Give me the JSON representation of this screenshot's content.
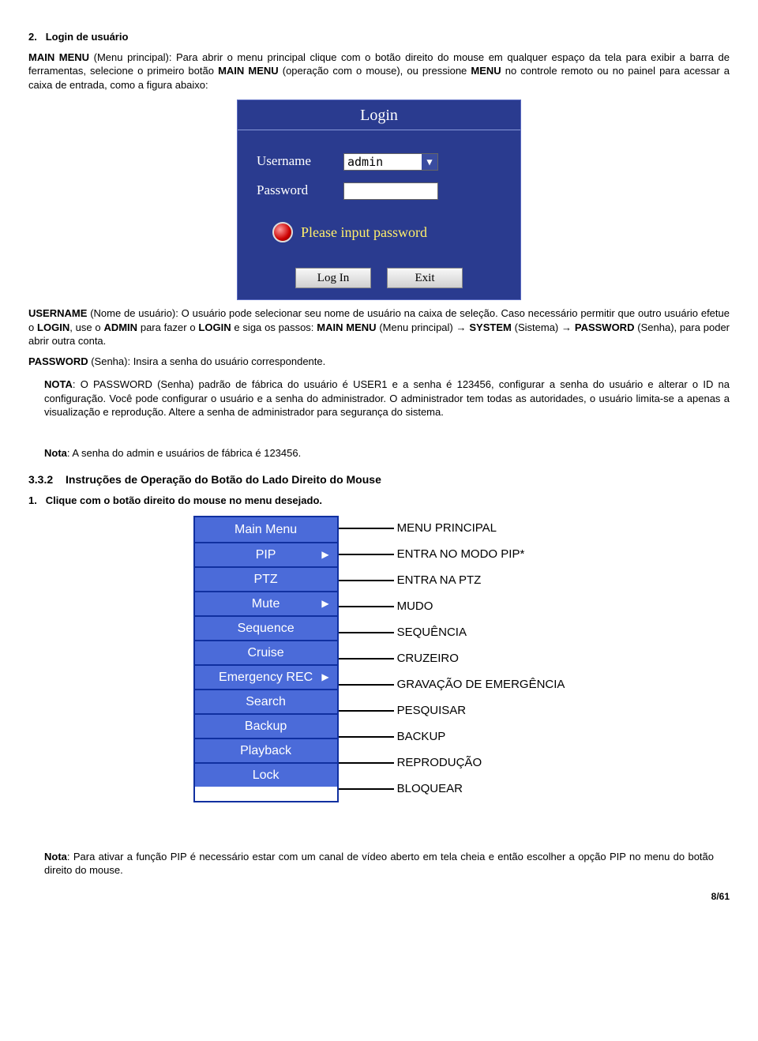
{
  "sec2": {
    "num": "2.",
    "title": "Login de usuário",
    "p1_a": "MAIN MENU",
    "p1_b": " (Menu principal): Para abrir o menu principal clique com o botão direito do mouse em qualquer espaço da tela para exibir a barra de ferramentas, selecione o primeiro botão ",
    "p1_c": "MAIN MENU",
    "p1_d": " (operação com o mouse), ou pressione ",
    "p1_e": "MENU",
    "p1_f": " no controle remoto ou no painel para acessar a caixa de entrada, como a figura abaixo:"
  },
  "login": {
    "title": "Login",
    "user_lbl": "Username",
    "user_val": "admin",
    "pass_lbl": "Password",
    "warn": "Please input password",
    "btn_login": "Log In",
    "btn_exit": "Exit"
  },
  "username_para": {
    "a": "USERNAME",
    "b": " (Nome de usuário): O usuário pode selecionar seu nome de usuário na caixa de seleção. Caso necessário permitir que outro usuário efetue o ",
    "c": "LOGIN",
    "d": ", use o ",
    "e": "ADMIN",
    "f": " para fazer o ",
    "g": "LOGIN",
    "h": " e siga os passos: ",
    "i": "MAIN MENU",
    "j": " (Menu principal) → ",
    "k": "SYSTEM",
    "l": " (Sistema) → ",
    "m": "PASSWORD",
    "n": " (Senha), para poder abrir outra conta."
  },
  "pass_line": {
    "a": "PASSWORD",
    "b": " (Senha): Insira a senha do usuário correspondente."
  },
  "note1": {
    "a": "NOTA",
    "b": ": O PASSWORD (Senha) padrão de fábrica do usuário é USER1 e a senha é 123456, configurar a senha do usuário e alterar o ID na configuração. Você pode configurar o usuário e a senha do administrador. O administrador tem todas as autoridades, o usuário limita-se a apenas a visualização e reprodução. Altere a senha de administrador para segurança do sistema."
  },
  "note2": {
    "a": "Nota",
    "b": ": A senha do admin e usuários de fábrica é 123456."
  },
  "h332": {
    "num": "3.3.2",
    "title": "Instruções de Operação do Botão do Lado Direito do Mouse"
  },
  "step1": {
    "num": "1.",
    "text": "Clique com o botão direito do mouse no menu desejado."
  },
  "menu": [
    {
      "label": "Main Menu",
      "arrow": false,
      "desc": "MENU PRINCIPAL"
    },
    {
      "label": "PIP",
      "arrow": true,
      "desc": "ENTRA NO MODO PIP*"
    },
    {
      "label": "PTZ",
      "arrow": false,
      "desc": "ENTRA NA PTZ"
    },
    {
      "label": "Mute",
      "arrow": true,
      "desc": "MUDO"
    },
    {
      "label": "Sequence",
      "arrow": false,
      "desc": "SEQUÊNCIA"
    },
    {
      "label": "Cruise",
      "arrow": false,
      "desc": "CRUZEIRO"
    },
    {
      "label": "Emergency REC",
      "arrow": true,
      "desc": "GRAVAÇÃO DE EMERGÊNCIA"
    },
    {
      "label": "Search",
      "arrow": false,
      "desc": "PESQUISAR"
    },
    {
      "label": "Backup",
      "arrow": false,
      "desc": "BACKUP"
    },
    {
      "label": "Playback",
      "arrow": false,
      "desc": "REPRODUÇÃO"
    },
    {
      "label": "Lock",
      "arrow": false,
      "desc": "BLOQUEAR"
    }
  ],
  "final_note": {
    "a": "Nota",
    "b": ": Para ativar a função PIP é necessário estar com um canal de vídeo aberto em tela cheia e então escolher a opção PIP no menu do botão direito do mouse."
  },
  "page": "8/61",
  "glyphs": {
    "tri": "▶",
    "dd": "▼"
  }
}
